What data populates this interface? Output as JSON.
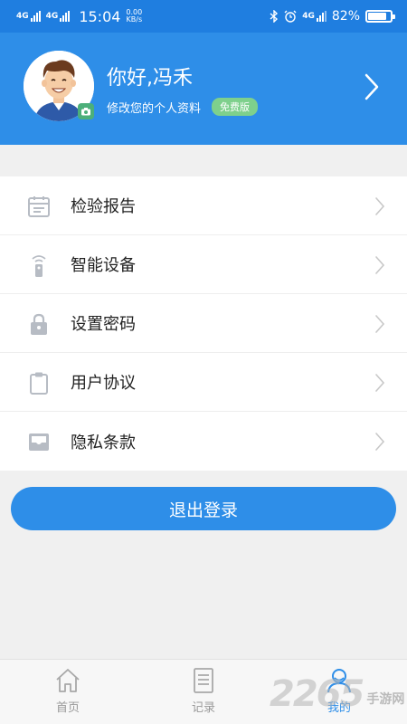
{
  "status_bar": {
    "net1": "4G",
    "net2": "4G",
    "time": "15:04",
    "speed_value": "0.00",
    "speed_unit": "KB/s",
    "net3": "4G",
    "battery_pct": "82%",
    "battery_level": 0.82
  },
  "header": {
    "greeting": "你好,冯禾",
    "subtitle": "修改您的个人资料",
    "badge": "免费版"
  },
  "menu": {
    "items": [
      {
        "label": "检验报告",
        "icon": "calendar-icon"
      },
      {
        "label": "智能设备",
        "icon": "remote-device-icon"
      },
      {
        "label": "设置密码",
        "icon": "lock-icon"
      },
      {
        "label": "用户协议",
        "icon": "clipboard-icon"
      },
      {
        "label": "隐私条款",
        "icon": "inbox-icon"
      }
    ]
  },
  "logout_label": "退出登录",
  "tabs": [
    {
      "label": "首页",
      "icon": "home-icon",
      "active": false
    },
    {
      "label": "记录",
      "icon": "document-icon",
      "active": false
    },
    {
      "label": "我的",
      "icon": "user-icon",
      "active": true
    }
  ],
  "watermark": {
    "number": "2265",
    "text": "手游网"
  },
  "colors": {
    "primary": "#2e8ee8",
    "status_bar": "#1f7ee0",
    "badge": "#7ed08c",
    "background": "#f0f0f0"
  }
}
